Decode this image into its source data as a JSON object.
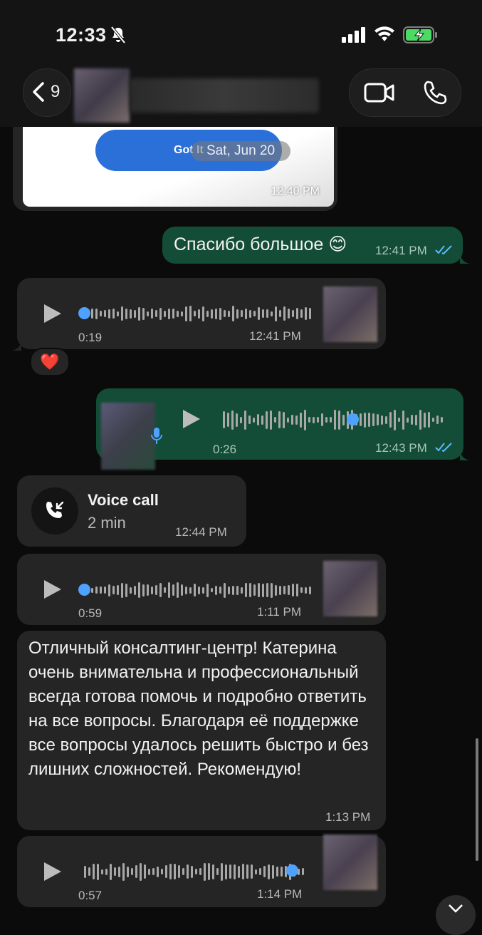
{
  "status_bar": {
    "time": "12:33"
  },
  "header": {
    "back_count": "9"
  },
  "date_chip": "Sat, Jun 20",
  "messages": {
    "image": {
      "button_label": "Got It",
      "time": "12:40 PM"
    },
    "thanks": {
      "text": "Спасибо большое 😊",
      "time": "12:41 PM"
    },
    "voice1": {
      "duration": "0:19",
      "time": "12:41 PM",
      "reaction": "❤️"
    },
    "voice2": {
      "duration": "0:26",
      "time": "12:43 PM"
    },
    "call": {
      "title": "Voice call",
      "duration": "2 min",
      "time": "12:44 PM"
    },
    "voice3": {
      "duration": "0:59",
      "time": "1:11 PM"
    },
    "review": {
      "text": "Отличный консалтинг-центр! Катерина очень внимательна и профессиональный всегда готова помочь и подробно ответить на все вопросы. Благодаря её поддержке все вопросы удалось решить быстро и без лишних сложностей. Рекомендую!",
      "time": "1:13 PM"
    },
    "voice4": {
      "duration": "0:57",
      "time": "1:14 PM"
    }
  },
  "colors": {
    "outgoing": "#144d37",
    "incoming": "#252525",
    "accent": "#4ea1ff",
    "read_ticks": "#5cb8ff"
  },
  "icons": [
    "bell-slash-icon",
    "signal-icon",
    "wifi-icon",
    "battery-charging-icon",
    "chevron-left-icon",
    "video-icon",
    "phone-icon",
    "play-icon",
    "mic-icon",
    "incoming-call-icon",
    "double-check-icon",
    "chevron-down-icon"
  ]
}
